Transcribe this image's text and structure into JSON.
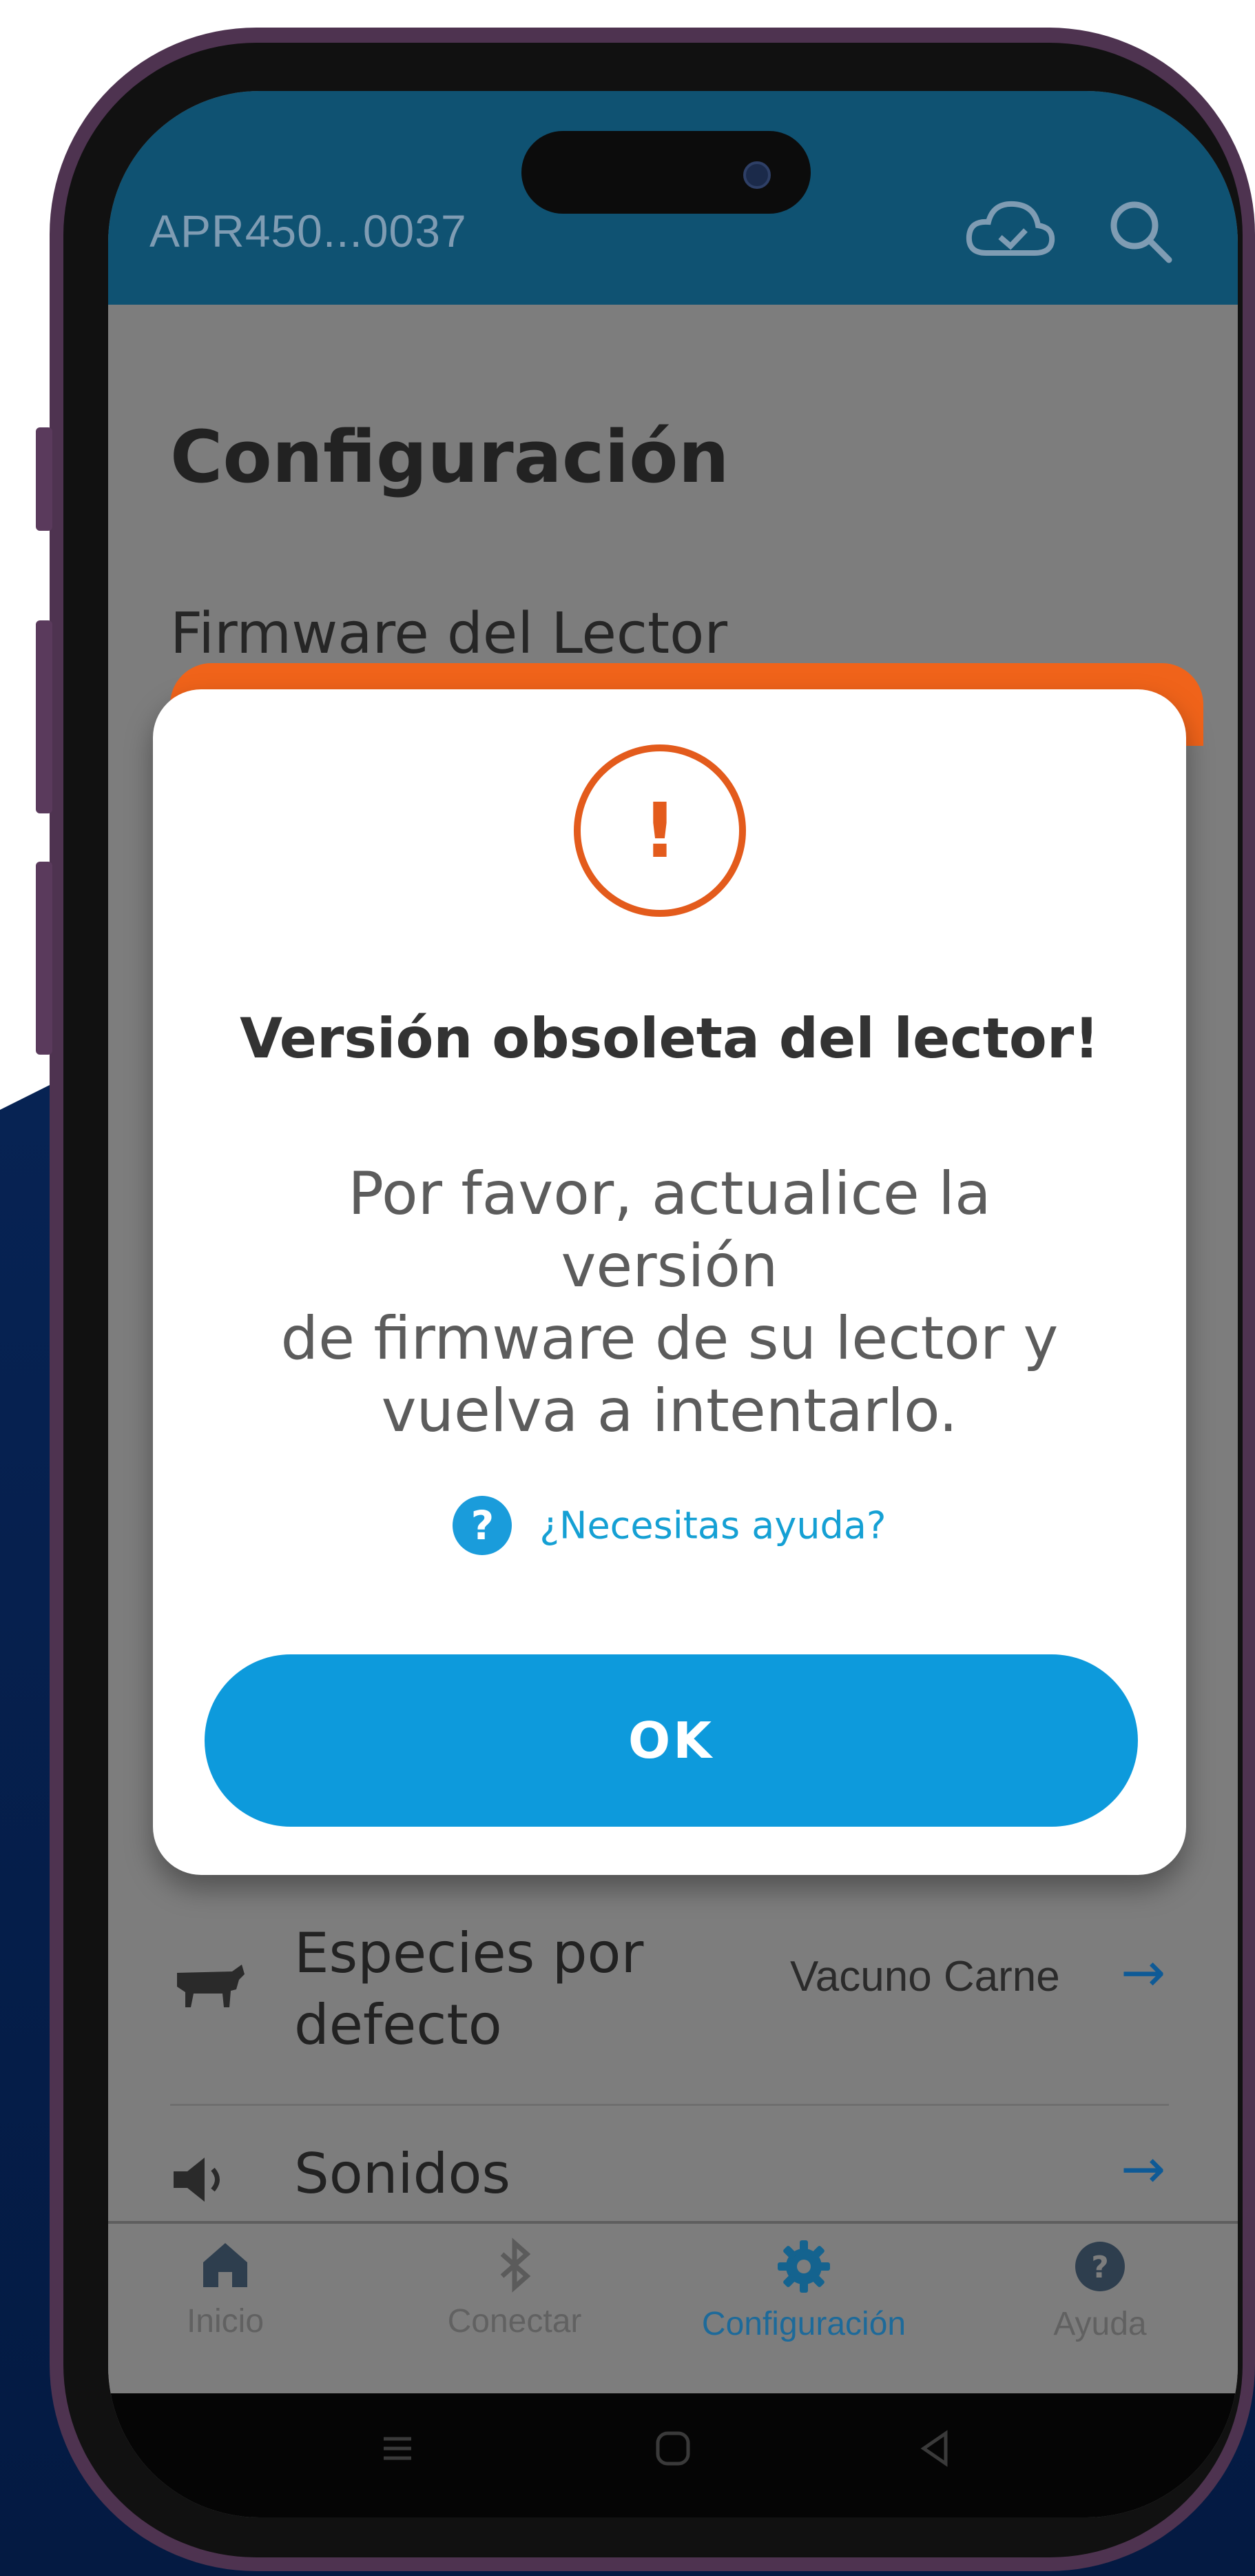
{
  "appbar": {
    "title": "APR450...0037",
    "icons": [
      "cloud-sync-icon",
      "search-icon"
    ]
  },
  "page": {
    "title": "Configuración",
    "section_label": "Firmware del Lector"
  },
  "settings": [
    {
      "icon": "cow-icon",
      "label_line1": "Especies por",
      "label_line2": "defecto",
      "value": "Vacuno Carne",
      "arrow": "→"
    },
    {
      "icon": "speaker-icon",
      "label_line1": "Sonidos",
      "value": "",
      "arrow": "→"
    }
  ],
  "dialog": {
    "icon_glyph": "!",
    "title": "Versión obsoleta del lector!",
    "body_lines": [
      "Por favor, actualice la versión",
      "de firmware de su lector y",
      "vuelva a intentarlo."
    ],
    "help_icon_glyph": "?",
    "help_text": "¿Necesitas ayuda?",
    "ok_label": "OK"
  },
  "bottom_nav": [
    {
      "label": "Inicio",
      "icon": "home-icon",
      "active": false
    },
    {
      "label": "Conectar",
      "icon": "bluetooth-icon",
      "active": false
    },
    {
      "label": "Configuración",
      "icon": "gear-icon",
      "active": true
    },
    {
      "label": "Ayuda",
      "icon": "help-circle-icon",
      "active": false
    }
  ],
  "colors": {
    "appbar": "#0f5272",
    "accent": "#0d9adc",
    "warning": "#e35b1c",
    "scrim": "#7d7d7d"
  }
}
